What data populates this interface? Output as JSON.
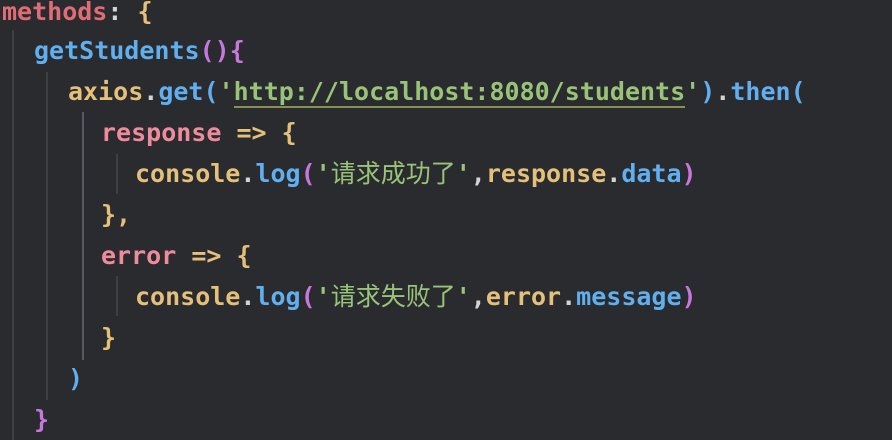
{
  "code": {
    "line1": {
      "name": "methods",
      "colon": ":",
      "brace": " {"
    },
    "line2": {
      "name": "getStudents",
      "parens": "()",
      "brace": "{"
    },
    "line3": {
      "obj": "axios",
      "dot1": ".",
      "method": "get",
      "open": "(",
      "q1": "'",
      "url": "http://localhost:8080/students",
      "q2": "'",
      "close": ")",
      "dot2": ".",
      "then": "then",
      "open2": "("
    },
    "line4": {
      "param": "response",
      "arrow": " =>",
      "brace": " {"
    },
    "line5": {
      "obj": "console",
      "dot": ".",
      "method": "log",
      "open": "(",
      "q1": "'",
      "text": "请求成功了",
      "q2": "'",
      "comma": ",",
      "arg": "response",
      "dot2": ".",
      "prop": "data",
      "close": ")"
    },
    "line6": {
      "text": "},"
    },
    "line7": {
      "param": "error",
      "arrow": " =>",
      "brace": " {"
    },
    "line8": {
      "obj": "console",
      "dot": ".",
      "method": "log",
      "open": "(",
      "q1": "'",
      "text": "请求失败了",
      "q2": "'",
      "comma": ",",
      "arg": "error",
      "dot2": ".",
      "prop": "message",
      "close": ")"
    },
    "line9": {
      "text": "}"
    },
    "line10": {
      "text": ")"
    },
    "line11": {
      "text": "}"
    }
  }
}
